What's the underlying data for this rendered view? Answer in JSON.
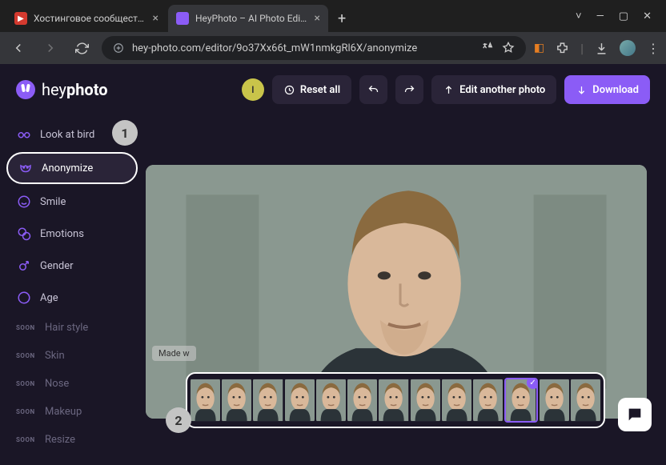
{
  "browser": {
    "tabs": [
      {
        "title": "Хостинговое сообщество «Tin",
        "favicon_bg": "#d43a2f",
        "active": false
      },
      {
        "title": "HeyPhoto – AI Photo Editor On…",
        "favicon_bg": "#8b5cf6",
        "active": true
      }
    ],
    "url": "hey-photo.com/editor/9o37Xx66t_mW1nmkgRl6X/anonymize"
  },
  "logo": {
    "prefix": "hey",
    "bold": "photo"
  },
  "user_initial": "I",
  "toolbar": {
    "reset_label": "Reset all",
    "edit_another_label": "Edit another photo",
    "download_label": "Download"
  },
  "sidebar": {
    "items": [
      {
        "label": "Look at bird",
        "icon": "glasses",
        "active": false,
        "soon": false
      },
      {
        "label": "Anonymize",
        "icon": "mask",
        "active": true,
        "soon": false
      },
      {
        "label": "Smile",
        "icon": "smile",
        "active": false,
        "soon": false
      },
      {
        "label": "Emotions",
        "icon": "emotions",
        "active": false,
        "soon": false
      },
      {
        "label": "Gender",
        "icon": "gender",
        "active": false,
        "soon": false
      },
      {
        "label": "Age",
        "icon": "age",
        "active": false,
        "soon": false
      },
      {
        "label": "Hair style",
        "icon": "soon",
        "active": false,
        "soon": true
      },
      {
        "label": "Skin",
        "icon": "soon",
        "active": false,
        "soon": true
      },
      {
        "label": "Nose",
        "icon": "soon",
        "active": false,
        "soon": true
      },
      {
        "label": "Makeup",
        "icon": "soon",
        "active": false,
        "soon": true
      },
      {
        "label": "Resize",
        "icon": "soon",
        "active": false,
        "soon": true
      }
    ],
    "soon_badge": "SOON"
  },
  "canvas": {
    "watermark": "Made w"
  },
  "steps": {
    "one": "1",
    "two": "2"
  },
  "thumbnails": {
    "count": 13,
    "selected_index": 10
  }
}
